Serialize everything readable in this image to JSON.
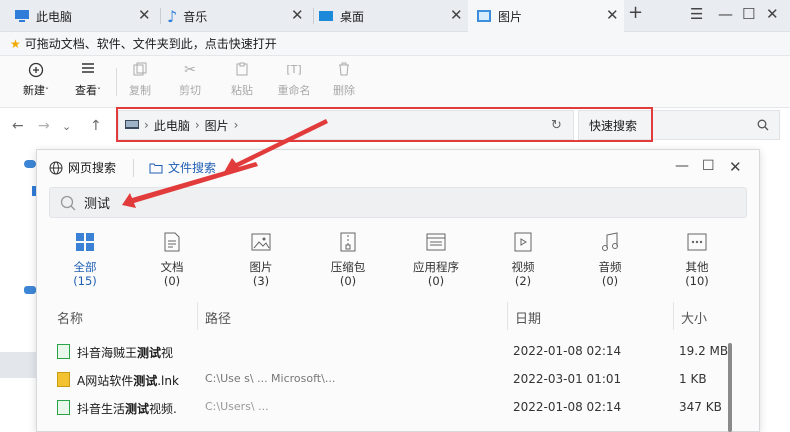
{
  "tabs": [
    {
      "label": "此电脑",
      "icon": "computer-icon"
    },
    {
      "label": "音乐",
      "icon": "music-icon"
    },
    {
      "label": "桌面",
      "icon": "desktop-icon"
    },
    {
      "label": "图片",
      "icon": "pictures-icon"
    }
  ],
  "window_controls": {
    "minimize": "—",
    "maximize": "☐",
    "close": "✕"
  },
  "tip": {
    "icon": "star-icon",
    "text": "可拖动文档、软件、文件夹到此，点击快速打开"
  },
  "ribbon": [
    {
      "label": "新建",
      "icon": "new-icon"
    },
    {
      "label": "查看",
      "icon": "view-icon"
    },
    {
      "label": "复制",
      "icon": "copy-icon"
    },
    {
      "label": "剪切",
      "icon": "cut-icon"
    },
    {
      "label": "粘贴",
      "icon": "paste-icon"
    },
    {
      "label": "重命名",
      "icon": "rename-icon"
    },
    {
      "label": "删除",
      "icon": "delete-icon"
    }
  ],
  "address": {
    "segments": [
      "此电脑",
      "图片"
    ]
  },
  "quick_search": {
    "label": "快速搜索"
  },
  "popup": {
    "tabs": [
      {
        "label": "网页搜索"
      },
      {
        "label": "文件搜索"
      }
    ],
    "search_value": "测试",
    "categories": [
      {
        "label": "全部",
        "count": "(15)",
        "icon": "all-icon"
      },
      {
        "label": "文档",
        "count": "(0)",
        "icon": "document-icon"
      },
      {
        "label": "图片",
        "count": "(3)",
        "icon": "image-icon"
      },
      {
        "label": "压缩包",
        "count": "(0)",
        "icon": "archive-icon"
      },
      {
        "label": "应用程序",
        "count": "(0)",
        "icon": "application-icon"
      },
      {
        "label": "视频",
        "count": "(2)",
        "icon": "video-icon"
      },
      {
        "label": "音频",
        "count": "(0)",
        "icon": "audio-icon"
      },
      {
        "label": "其他",
        "count": "(10)",
        "icon": "other-icon"
      }
    ],
    "columns": {
      "name": "名称",
      "path": "路径",
      "date": "日期",
      "size": "大小"
    },
    "rows": [
      {
        "pre": "抖音海贼王",
        "match": "测试",
        "post": "视",
        "path": "",
        "date": "2022-01-08 02:14",
        "size": "19.2 MB"
      },
      {
        "pre": "A网站软件",
        "match": "测试",
        "post": ".lnk",
        "path": "C:\\Use s\\ ... Microsoft\\...",
        "date": "2022-03-01 01:01",
        "size": "1 KB"
      },
      {
        "pre": "抖音生活",
        "match": "测试",
        "post": "视频.",
        "path": "C:\\Users\\ ...",
        "date": "2022-01-08 02:14",
        "size": "347 KB"
      }
    ]
  },
  "colors": {
    "accent": "#1f5fb3",
    "annotation_red": "#e23b3b"
  }
}
